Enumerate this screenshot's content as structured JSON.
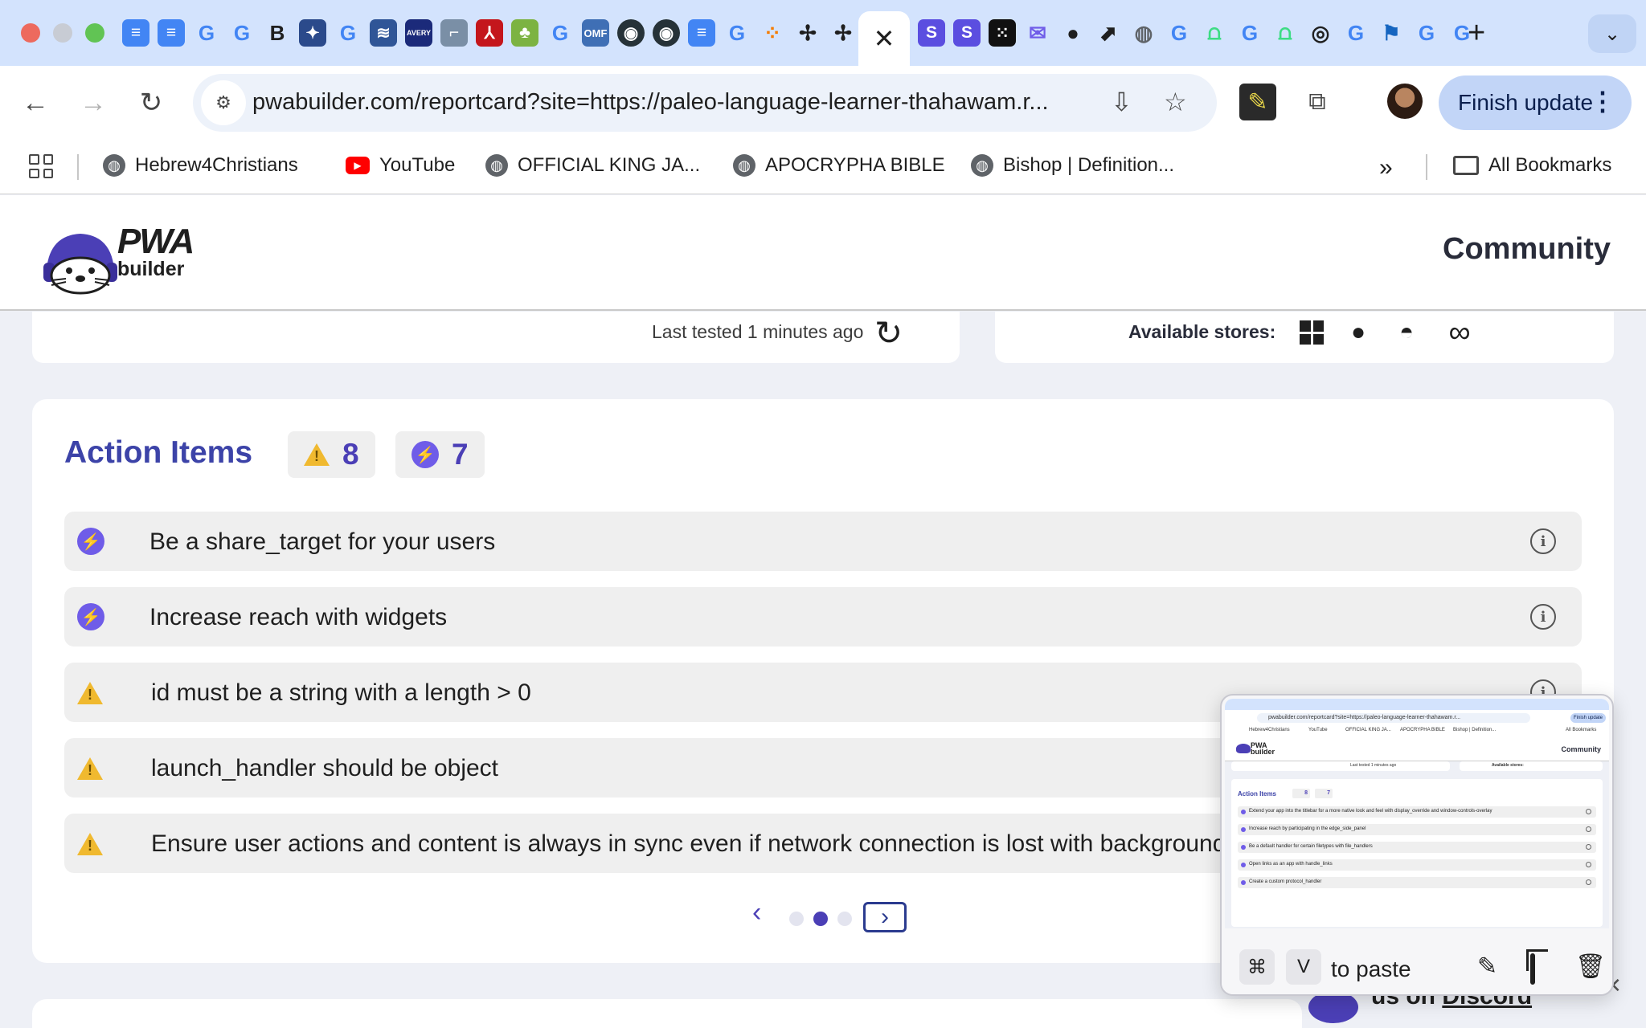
{
  "browser": {
    "active_tab_close": "✕",
    "new_tab": "+",
    "tab_search": "⌄",
    "url": "pwabuilder.com/reportcard?site=https://paleo-language-learner-thahawam.r...",
    "finish_update": "Finish update",
    "bookmarks": [
      {
        "label": "Hebrew4Christians",
        "icon": "globe-icon"
      },
      {
        "label": "YouTube",
        "icon": "youtube-icon"
      },
      {
        "label": "OFFICIAL KING JA...",
        "icon": "globe-icon"
      },
      {
        "label": "APOCRYPHA BIBLE",
        "icon": "globe-icon"
      },
      {
        "label": "Bishop | Definition...",
        "icon": "globe-icon"
      }
    ],
    "more_bookmarks": "»",
    "all_bookmarks": "All Bookmarks"
  },
  "site": {
    "logo_pwa": "PWA",
    "logo_builder": "builder",
    "nav_community": "Community"
  },
  "status": {
    "last_tested": "Last tested 1 minutes ago",
    "available_stores_label": "Available stores:",
    "stores": [
      "windows-icon",
      "apple-icon",
      "android-icon",
      "meta-icon"
    ]
  },
  "action_items": {
    "title": "Action Items",
    "warning_count": "8",
    "enhancement_count": "7",
    "items": [
      {
        "type": "enhancement",
        "text": "Be a share_target for your users"
      },
      {
        "type": "enhancement",
        "text": "Increase reach with widgets"
      },
      {
        "type": "warning",
        "text": "id must be a string with a length > 0"
      },
      {
        "type": "warning",
        "text": "launch_handler should be object"
      },
      {
        "type": "warning",
        "text": "Ensure user actions and content is always in sync even if network connection is lost with background"
      }
    ],
    "pager": {
      "prev": "‹",
      "next": "›",
      "page_count": 3,
      "current_page": 2
    }
  },
  "discord": {
    "text_prefix": "us on ",
    "link": "Discord"
  },
  "screenshot_overlay": {
    "key_cmd": "⌘",
    "key_v": "V",
    "paste_text": "to paste",
    "thumb": {
      "url": "pwabuilder.com/reportcard?site=https://paleo-language-learner-thahawam.r...",
      "finish": "Finish update",
      "bookmarks": [
        "Hebrew4Christians",
        "YouTube",
        "OFFICIAL KING JA...",
        "APOCRYPHA BIBLE",
        "Bishop | Definition..."
      ],
      "all_bookmarks": "All Bookmarks",
      "community": "Community",
      "last_tested": "Last tested 1 minutes ago",
      "stores": "Available stores:",
      "title": "Action Items",
      "warn": "8",
      "enh": "7",
      "items": [
        "Extend your app into the titlebar for a more native look and feel with display_override and window-controls-overlay",
        "Increase reach by participating in the edge_side_panel",
        "Be a default handler for certain filetypes with file_handlers",
        "Open links as an app with handle_links",
        "Create a custom protocol_handler"
      ]
    }
  },
  "colors": {
    "accent": "#4b3fb6",
    "title": "#3c43a8",
    "warning": "#f0b92f",
    "enhancement": "#6f5ce8"
  }
}
